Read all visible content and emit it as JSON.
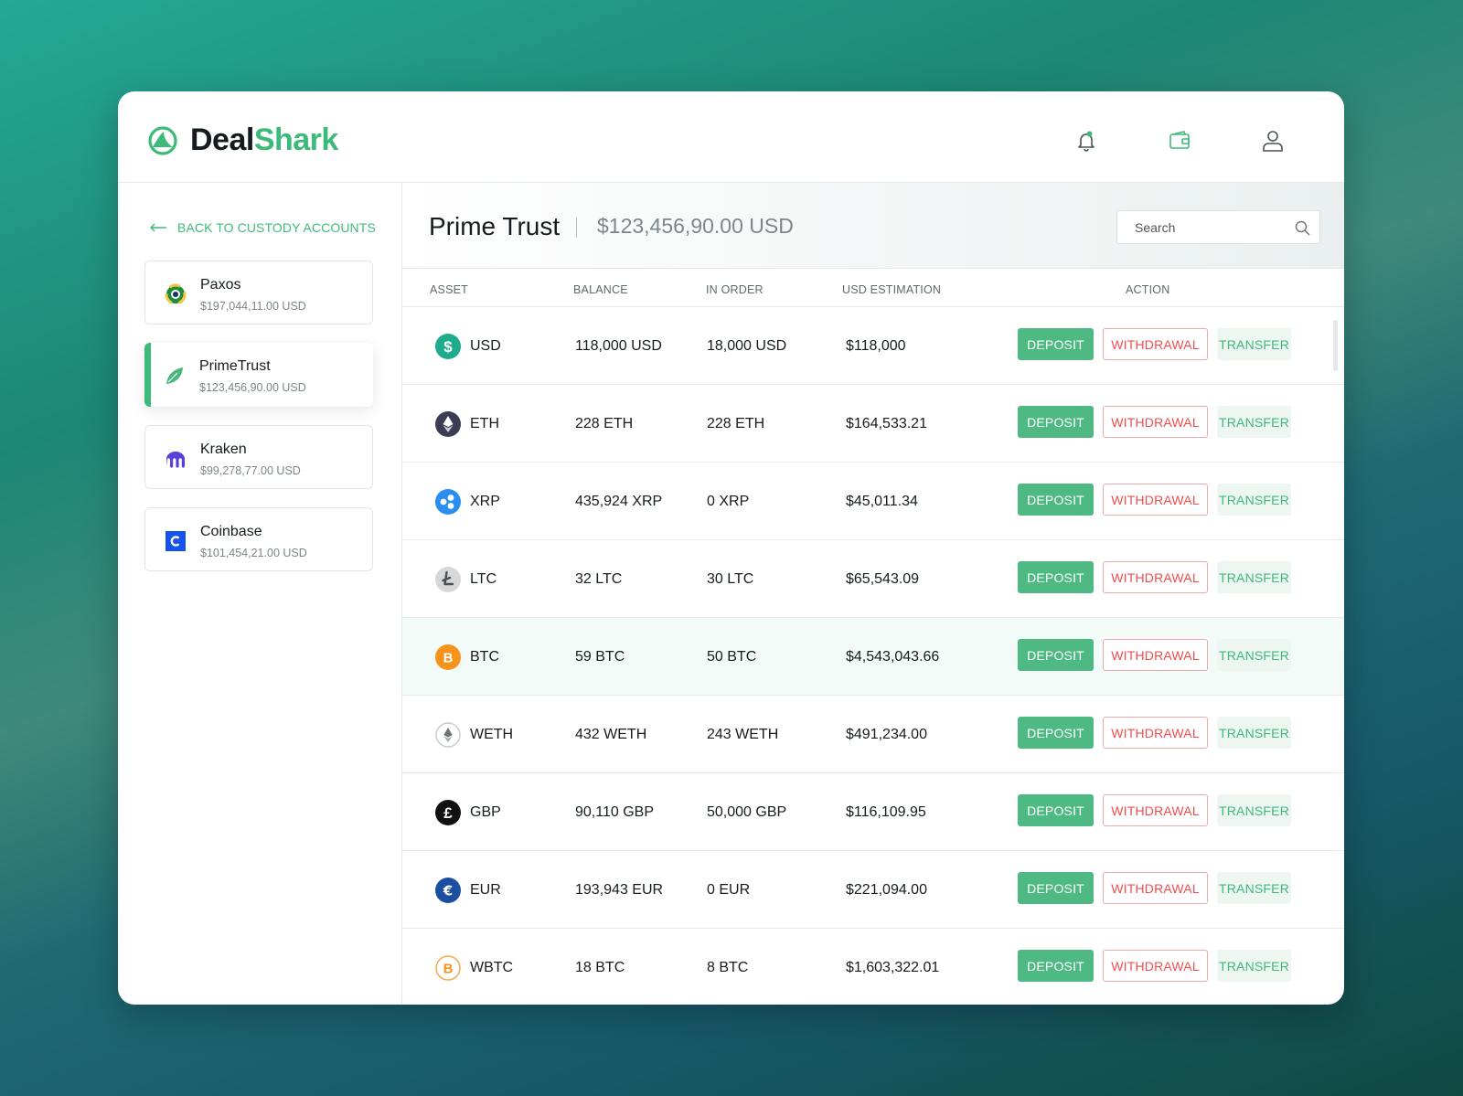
{
  "brand": {
    "name_part1": "Deal",
    "name_part2": "Shark",
    "accent": "#3dba7a"
  },
  "header_icons": [
    "bell-icon",
    "wallet-icon",
    "user-icon"
  ],
  "sidebar": {
    "back_label": "BACK TO CUSTODY ACCOUNTS",
    "accounts": [
      {
        "name": "Paxos",
        "balance": "$197,044,11.00 USD",
        "icon": "paxos-icon"
      },
      {
        "name": "PrimeTrust",
        "balance": "$123,456,90.00 USD",
        "icon": "leaf-icon",
        "active": true
      },
      {
        "name": "Kraken",
        "balance": "$99,278,77.00 USD",
        "icon": "kraken-icon"
      },
      {
        "name": "Coinbase",
        "balance": "$101,454,21.00 USD",
        "icon": "coinbase-icon"
      }
    ]
  },
  "main": {
    "title": "Prime Trust",
    "total": "$123,456,90.00 USD",
    "search_placeholder": "Search",
    "columns": {
      "asset": "ASSET",
      "balance": "BALANCE",
      "in_order": "IN ORDER",
      "usd": "USD ESTIMATION",
      "action": "ACTION"
    },
    "actions": {
      "deposit": "DEPOSIT",
      "withdrawal": "WITHDRAWAL",
      "transfer": "TRANSFER"
    },
    "rows": [
      {
        "asset": "USD",
        "balance": "118,000 USD",
        "in_order": "18,000 USD",
        "usd": "$118,000",
        "icon": "usd-icon",
        "color": "#1fab8e"
      },
      {
        "asset": "ETH",
        "balance": "228 ETH",
        "in_order": "228 ETH",
        "usd": "$164,533.21",
        "icon": "eth-icon",
        "color": "#3b3d55"
      },
      {
        "asset": "XRP",
        "balance": "435,924 XRP",
        "in_order": "0 XRP",
        "usd": "$45,011.34",
        "icon": "xrp-icon",
        "color": "#2a8ff0"
      },
      {
        "asset": "LTC",
        "balance": "32 LTC",
        "in_order": "30 LTC",
        "usd": "$65,543.09",
        "icon": "ltc-icon",
        "color": "#d5d7d8"
      },
      {
        "asset": "BTC",
        "balance": "59 BTC",
        "in_order": "50 BTC",
        "usd": "$4,543,043.66",
        "icon": "btc-icon",
        "color": "#f7931a",
        "highlight": true
      },
      {
        "asset": "WETH",
        "balance": "432 WETH",
        "in_order": "243 WETH",
        "usd": "$491,234.00",
        "icon": "weth-icon",
        "color": "#ffffff"
      },
      {
        "asset": "GBP",
        "balance": "90,110 GBP",
        "in_order": "50,000 GBP",
        "usd": "$116,109.95",
        "icon": "gbp-icon",
        "color": "#111111"
      },
      {
        "asset": "EUR",
        "balance": "193,943 EUR",
        "in_order": "0 EUR",
        "usd": "$221,094.00",
        "icon": "eur-icon",
        "color": "#1d4fa0"
      },
      {
        "asset": "WBTC",
        "balance": "18 BTC",
        "in_order": "8 BTC",
        "usd": "$1,603,322.01",
        "icon": "wbtc-icon",
        "color": "#ffffff"
      }
    ]
  }
}
